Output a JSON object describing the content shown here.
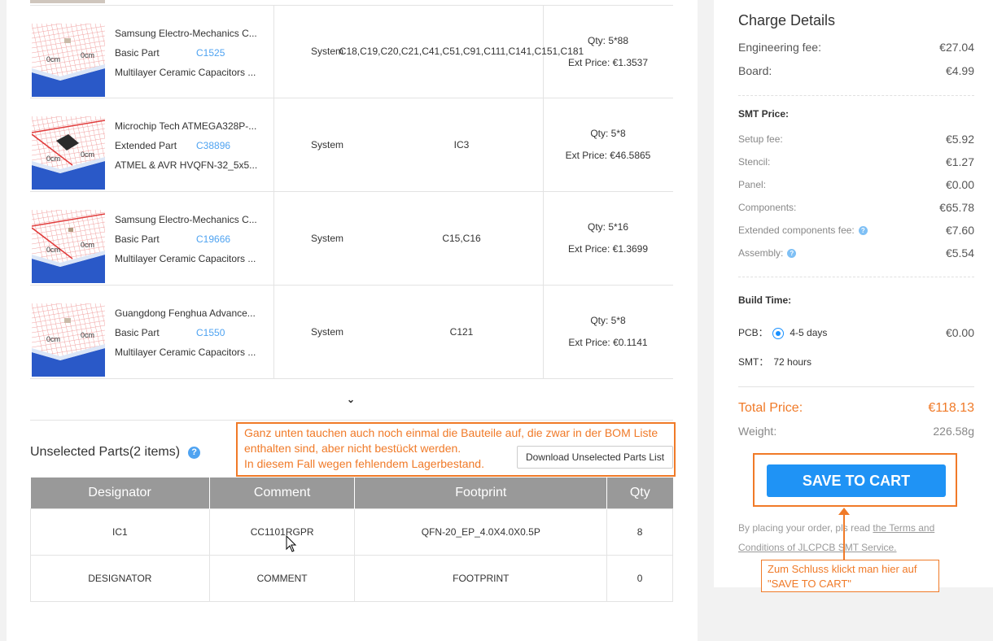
{
  "parts": [
    {
      "name": "Samsung Electro-Mechanics C...",
      "type": "Basic Part",
      "code": "C1525",
      "desc": "Multilayer Ceramic Capacitors ...",
      "source": "System",
      "designators": "C18,C19,C20,C21,C41,C51,C91,C111,C141,C151,C181",
      "qty": "Qty: 5*88",
      "ext_price": "Ext Price: €1.3537",
      "thumb": "ceramic"
    },
    {
      "name": "Microchip Tech ATMEGA328P-...",
      "type": "Extended Part",
      "code": "C38896",
      "desc": "ATMEL & AVR HVQFN-32_5x5...",
      "source": "System",
      "designators": "IC3",
      "qty": "Qty: 5*8",
      "ext_price": "Ext Price: €46.5865",
      "thumb": "chip"
    },
    {
      "name": "Samsung Electro-Mechanics C...",
      "type": "Basic Part",
      "code": "C19666",
      "desc": "Multilayer Ceramic Capacitors ...",
      "source": "System",
      "designators": "C15,C16",
      "qty": "Qty: 5*16",
      "ext_price": "Ext Price: €1.3699",
      "thumb": "ceramic-red"
    },
    {
      "name": "Guangdong Fenghua Advance...",
      "type": "Basic Part",
      "code": "C1550",
      "desc": "Multilayer Ceramic Capacitors ...",
      "source": "System",
      "designators": "C121",
      "qty": "Qty: 5*8",
      "ext_price": "Ext Price: €0.1141",
      "thumb": "ceramic"
    }
  ],
  "unselected": {
    "title": "Unselected Parts(2 items)",
    "download_label": "Download Unselected Parts List",
    "columns": [
      "Designator",
      "Comment",
      "Footprint",
      "Qty"
    ],
    "rows": [
      [
        "IC1",
        "CC1101RGPR",
        "QFN-20_EP_4.0X4.0X0.5P",
        "8"
      ],
      [
        "DESIGNATOR",
        "COMMENT",
        "FOOTPRINT",
        "0"
      ]
    ]
  },
  "charge": {
    "title": "Charge Details",
    "engineering_fee": {
      "label": "Engineering fee:",
      "value": "€27.04"
    },
    "board": {
      "label": "Board:",
      "value": "€4.99"
    },
    "smt_price_label": "SMT Price:",
    "smt": [
      {
        "label": "Setup fee:",
        "value": "€5.92",
        "help": false
      },
      {
        "label": "Stencil:",
        "value": "€1.27",
        "help": false
      },
      {
        "label": "Panel:",
        "value": "€0.00",
        "help": false
      },
      {
        "label": "Components:",
        "value": "€65.78",
        "help": false
      },
      {
        "label": "Extended components fee:",
        "value": "€7.60",
        "help": true
      },
      {
        "label": "Assembly:",
        "value": "€5.54",
        "help": true
      }
    ],
    "build_time_label": "Build Time:",
    "pcb_label": "PCB：",
    "pcb_option": "4-5 days",
    "pcb_value": "€0.00",
    "smt_label": "SMT：",
    "smt_time": "72 hours",
    "total_label": "Total Price:",
    "total_value": "€118.13",
    "weight_label": "Weight:",
    "weight_value": "226.58g",
    "save_label": "SAVE TO CART",
    "terms_prefix": "By placing your order, pls read ",
    "terms_link": "the Terms and Conditions of JLCPCB SMT Service."
  },
  "annotations": {
    "unselected_note": "Ganz unten tauchen auch noch einmal die Bauteile auf, die zwar in der BOM Liste enthalten sind, aber nicht bestückt werden.\nIn diesem Fall wegen fehlendem Lagerbestand.",
    "save_note": "Zum Schluss klickt man hier auf \"SAVE TO CART\""
  },
  "colors": {
    "accent_blue": "#1f93f5",
    "link_blue": "#4fa3f1",
    "annotation_orange": "#f07a28",
    "header_gray": "#999999"
  }
}
